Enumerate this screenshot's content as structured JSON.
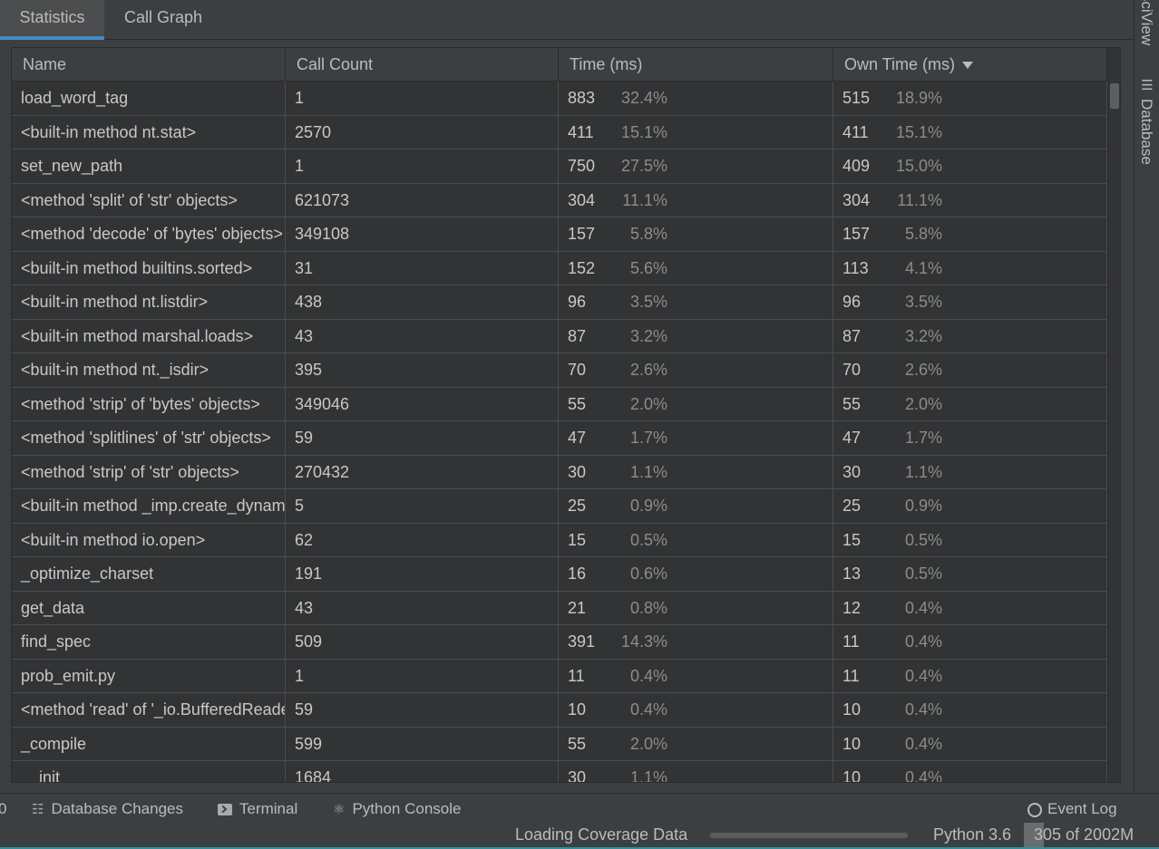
{
  "tabs": [
    {
      "label": "Statistics",
      "active": true
    },
    {
      "label": "Call Graph",
      "active": false
    }
  ],
  "right_strip": {
    "sciview_label": "SciView",
    "database_label": "Database"
  },
  "table": {
    "columns": [
      "Name",
      "Call Count",
      "Time (ms)",
      "Own Time (ms)"
    ],
    "sorted_column": "Own Time (ms)",
    "sort_direction": "descending",
    "rows": [
      {
        "name": "load_word_tag",
        "count": "1",
        "time": "883",
        "time_pct": "32.4%",
        "own": "515",
        "own_pct": "18.9%"
      },
      {
        "name": "<built-in method nt.stat>",
        "count": "2570",
        "time": "411",
        "time_pct": "15.1%",
        "own": "411",
        "own_pct": "15.1%"
      },
      {
        "name": "set_new_path",
        "count": "1",
        "time": "750",
        "time_pct": "27.5%",
        "own": "409",
        "own_pct": "15.0%"
      },
      {
        "name": "<method 'split' of 'str' objects>",
        "count": "621073",
        "time": "304",
        "time_pct": "11.1%",
        "own": "304",
        "own_pct": "11.1%"
      },
      {
        "name": "<method 'decode' of 'bytes' objects>",
        "count": "349108",
        "time": "157",
        "time_pct": "5.8%",
        "own": "157",
        "own_pct": "5.8%"
      },
      {
        "name": "<built-in method builtins.sorted>",
        "count": "31",
        "time": "152",
        "time_pct": "5.6%",
        "own": "113",
        "own_pct": "4.1%"
      },
      {
        "name": "<built-in method nt.listdir>",
        "count": "438",
        "time": "96",
        "time_pct": "3.5%",
        "own": "96",
        "own_pct": "3.5%"
      },
      {
        "name": "<built-in method marshal.loads>",
        "count": "43",
        "time": "87",
        "time_pct": "3.2%",
        "own": "87",
        "own_pct": "3.2%"
      },
      {
        "name": "<built-in method nt._isdir>",
        "count": "395",
        "time": "70",
        "time_pct": "2.6%",
        "own": "70",
        "own_pct": "2.6%"
      },
      {
        "name": "<method 'strip' of 'bytes' objects>",
        "count": "349046",
        "time": "55",
        "time_pct": "2.0%",
        "own": "55",
        "own_pct": "2.0%"
      },
      {
        "name": "<method 'splitlines' of 'str' objects>",
        "count": "59",
        "time": "47",
        "time_pct": "1.7%",
        "own": "47",
        "own_pct": "1.7%"
      },
      {
        "name": "<method 'strip' of 'str' objects>",
        "count": "270432",
        "time": "30",
        "time_pct": "1.1%",
        "own": "30",
        "own_pct": "1.1%"
      },
      {
        "name": "<built-in method _imp.create_dynamic>",
        "count": "5",
        "time": "25",
        "time_pct": "0.9%",
        "own": "25",
        "own_pct": "0.9%"
      },
      {
        "name": "<built-in method io.open>",
        "count": "62",
        "time": "15",
        "time_pct": "0.5%",
        "own": "15",
        "own_pct": "0.5%"
      },
      {
        "name": "_optimize_charset",
        "count": "191",
        "time": "16",
        "time_pct": "0.6%",
        "own": "13",
        "own_pct": "0.5%"
      },
      {
        "name": "get_data",
        "count": "43",
        "time": "21",
        "time_pct": "0.8%",
        "own": "12",
        "own_pct": "0.4%"
      },
      {
        "name": "find_spec",
        "count": "509",
        "time": "391",
        "time_pct": "14.3%",
        "own": "11",
        "own_pct": "0.4%"
      },
      {
        "name": "prob_emit.py",
        "count": "1",
        "time": "11",
        "time_pct": "0.4%",
        "own": "11",
        "own_pct": "0.4%"
      },
      {
        "name": "<method 'read' of '_io.BufferedReader' objects>",
        "count": "59",
        "time": "10",
        "time_pct": "0.4%",
        "own": "10",
        "own_pct": "0.4%"
      },
      {
        "name": "_compile",
        "count": "599",
        "time": "55",
        "time_pct": "2.0%",
        "own": "10",
        "own_pct": "0.4%"
      },
      {
        "name": "__init__",
        "count": "1684",
        "time": "30",
        "time_pct": "1.1%",
        "own": "10",
        "own_pct": "0.4%"
      }
    ]
  },
  "toolbar": {
    "edge_label": "0",
    "database_changes": "Database Changes",
    "terminal": "Terminal",
    "python_console": "Python Console",
    "event_log": "Event Log",
    "icons": {
      "database_changes": "database-changes-icon",
      "terminal": "terminal-icon",
      "python_console": "python-icon",
      "event_log": "event-log-icon"
    }
  },
  "status": {
    "loading_text": "Loading Coverage Data",
    "loading_progress": 0.0,
    "interpreter": "Python 3.6",
    "memory": "305 of 2002M",
    "memory_fraction": 0.15
  },
  "colors": {
    "background": "#3c3f41",
    "table_background": "#313335",
    "accent": "#4a88c7",
    "status_border": "#2f8f9a"
  }
}
